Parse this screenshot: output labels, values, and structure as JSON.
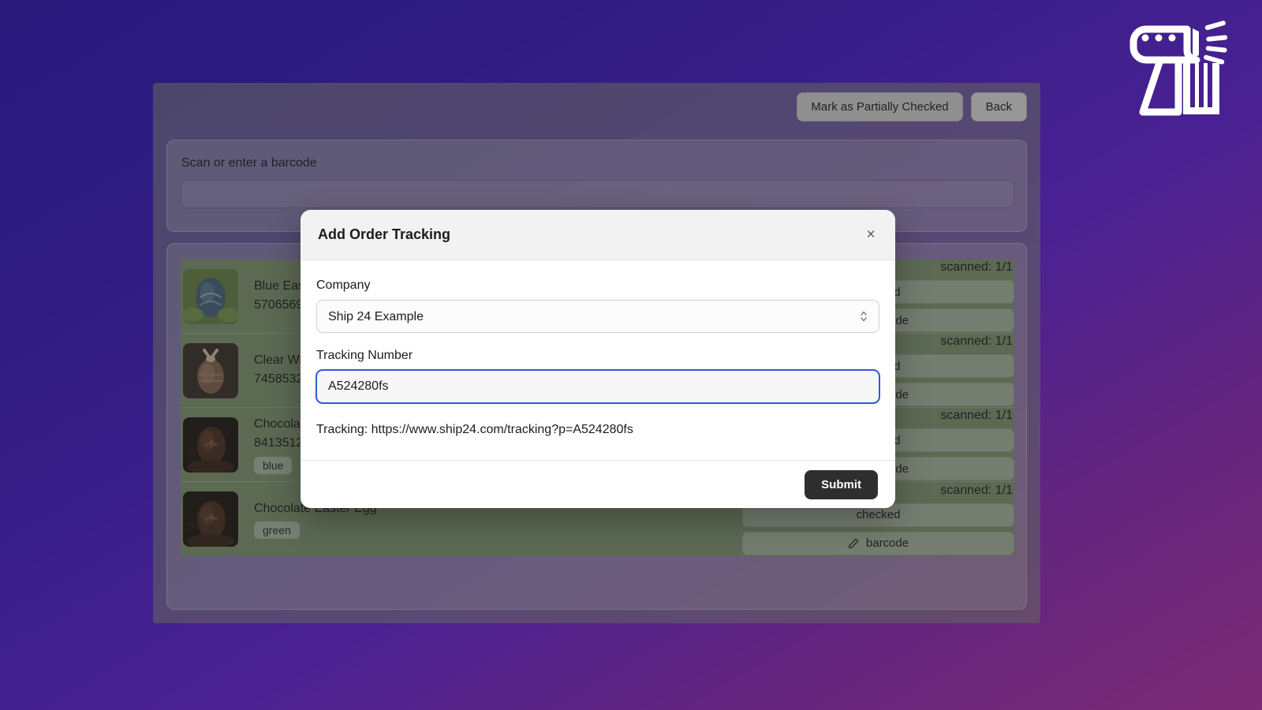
{
  "brand": {
    "logo_name": "barcode-scanner-logo"
  },
  "topbar": {
    "mark_partially_checked": "Mark as Partially Checked",
    "back": "Back"
  },
  "scan_card": {
    "label": "Scan or enter a barcode",
    "input_value": "",
    "input_placeholder": ""
  },
  "items": [
    {
      "title": "Blue Eas",
      "sku": "5706569",
      "tag": "",
      "scanned": "scanned: 1/1",
      "checked_label": "checked",
      "barcode_label": "barcode",
      "thumb": "blue-easter-egg"
    },
    {
      "title": "Clear Wr",
      "sku": "7458532",
      "tag": "",
      "scanned": "scanned: 1/1",
      "checked_label": "checked",
      "barcode_label": "barcode",
      "thumb": "wrapped-easter-egg"
    },
    {
      "title": "Chocola",
      "sku": "8413512",
      "tag": "blue",
      "scanned": "scanned: 1/1",
      "checked_label": "checked",
      "barcode_label": "barcode",
      "thumb": "chocolate-easter-egg"
    },
    {
      "title": "Chocolate Easter Egg",
      "sku": "",
      "tag": "green",
      "scanned": "scanned: 1/1",
      "checked_label": "checked",
      "barcode_label": "barcode",
      "thumb": "chocolate-easter-egg"
    }
  ],
  "modal": {
    "title": "Add Order Tracking",
    "close_label": "×",
    "company_label": "Company",
    "company_value": "Ship 24 Example",
    "company_options": [
      "Ship 24 Example"
    ],
    "tracking_label": "Tracking Number",
    "tracking_value": "A524280fs",
    "tracking_url_text": "Tracking: https://www.ship24.com/tracking?p=A524280fs",
    "submit_label": "Submit"
  },
  "colors": {
    "bg_gradient_start": "#2a1a7c",
    "bg_gradient_end": "#7b2a73",
    "row_green": "#87a078",
    "submit_dark": "#2e2e2e",
    "focus_blue": "#2b5fd9"
  }
}
